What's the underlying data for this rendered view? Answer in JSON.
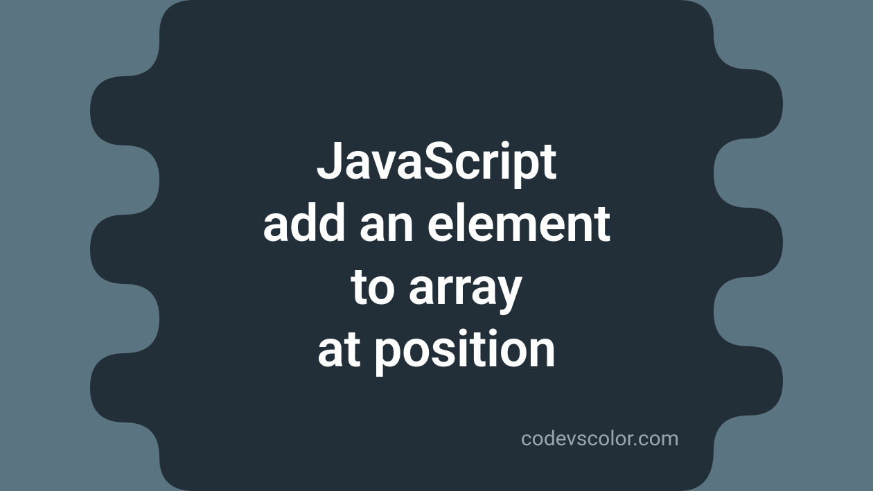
{
  "title": {
    "line1": "JavaScript",
    "line2": "add an element",
    "line3": "to array",
    "line4": "at position"
  },
  "attribution": "codevscolor.com",
  "colors": {
    "background": "#5a7481",
    "blob": "#232f38",
    "text_primary": "#ffffff",
    "text_secondary": "#9aa7ae"
  }
}
